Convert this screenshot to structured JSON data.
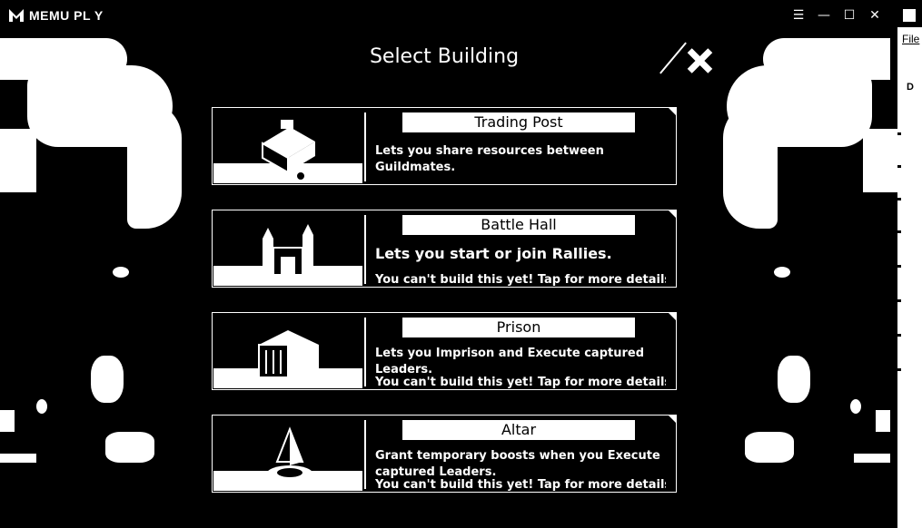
{
  "app": {
    "brand": "MEMU PL Y",
    "controls": {
      "menu": "☰",
      "minimize": "—",
      "maximize": "☐",
      "close": "✕"
    }
  },
  "side_panel": {
    "file_label": "File",
    "d_label": "D"
  },
  "dialog": {
    "title": "Select Building",
    "buildings": [
      {
        "name": "Trading Post",
        "description": "Lets you share resources between Guildmates.",
        "warning": ""
      },
      {
        "name": "Battle Hall",
        "description": "Lets you start or join Rallies.",
        "warning": "You can't build this yet! Tap for more details"
      },
      {
        "name": "Prison",
        "description": "Lets you Imprison and Execute captured Leaders.",
        "warning": "You can't build this yet! Tap for more details"
      },
      {
        "name": "Altar",
        "description": "Grant temporary boosts when you Execute captured Leaders.",
        "warning": "You can't build this yet! Tap for more details"
      }
    ]
  }
}
